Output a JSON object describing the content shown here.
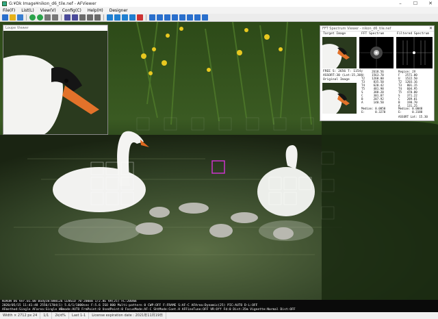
{
  "window": {
    "title": "G:¥Dk Image¥nikon_d6_tile.nef - AFViewer",
    "minimize": "–",
    "maximize": "☐",
    "close": "✕"
  },
  "menu": [
    "File(F)",
    "List(L)",
    "View(V)",
    "Config(C)",
    "Help(H)",
    "Designer"
  ],
  "loupe": {
    "title": "Loupe Viewer"
  },
  "fft": {
    "title": "FFT Spectrum Viewer - nikon_d6_tile.nef",
    "close": "✕",
    "target_label": "Target Image",
    "spectrum_label": "FFT Spectrum",
    "filtered_label": "Filtered Spectrum",
    "original_label": "Original Image",
    "info_line1": "FREE S: 2656 T: 1154",
    "info_line2": "ASSORT:30 (Lat:15,30)",
    "stats_left": "F     2618.56\nU:    1563.70\nT2    1268.00\nT3     835.50\nT4     620.42\nT5     481.98\nS      388.20\nC      301.87\nB      207.92\nA      140.50",
    "stats_mid_head": "Region: ",
    "median_text": "Median: 0.0050\nE:      0.3270",
    "stats_right": "Region: 2V\nF   2571.00\nU   1522.50\nT2  1203.16\nT3   801.15\nT4   604.95\nT5   470.00\nS    371.22\nC    289.01\nB    198.70\nA    131.25",
    "median_right": "Median: 0.0048\nE:      0.3188",
    "assort_right": "ASSORT Lat: 15.30"
  },
  "info_strip": {
    "line1": "NIKON D6 Ver.01.00  BodyCW:000126  LENSID 70-200mm 1/2.8E VR(25)  FL:200mm",
    "line2": "2020/05/15 11:41:48  2556/1704(1)    5.6/1/1000sec  F:5.6  ISO 800 Multi-pattern  0  CWP:OFF  F:FRAME  S:AF-C  AFArea:Dynamic(25)  PIC:AUTO  D-L:OFF",
    "line3": "AFmethod:Single  AFarea:Single  WBmode:AUTO  FrmPoint:0  UsedPoint:0  FocusMode:AF-C  ShtMode:Cont.H  AFFineTune:OFF  VR:Off  Fd:0  Dist:35m  Vignette:Normal  Dist:OFF"
  },
  "status": [
    "Width × 2712 px 24",
    "1/1",
    "2k/d%",
    "Last 1-1",
    "License expiration date : 2021年11月19日"
  ],
  "colors": {
    "loupe_frame": "#cc33cc",
    "af_grid": "#ffffff"
  }
}
